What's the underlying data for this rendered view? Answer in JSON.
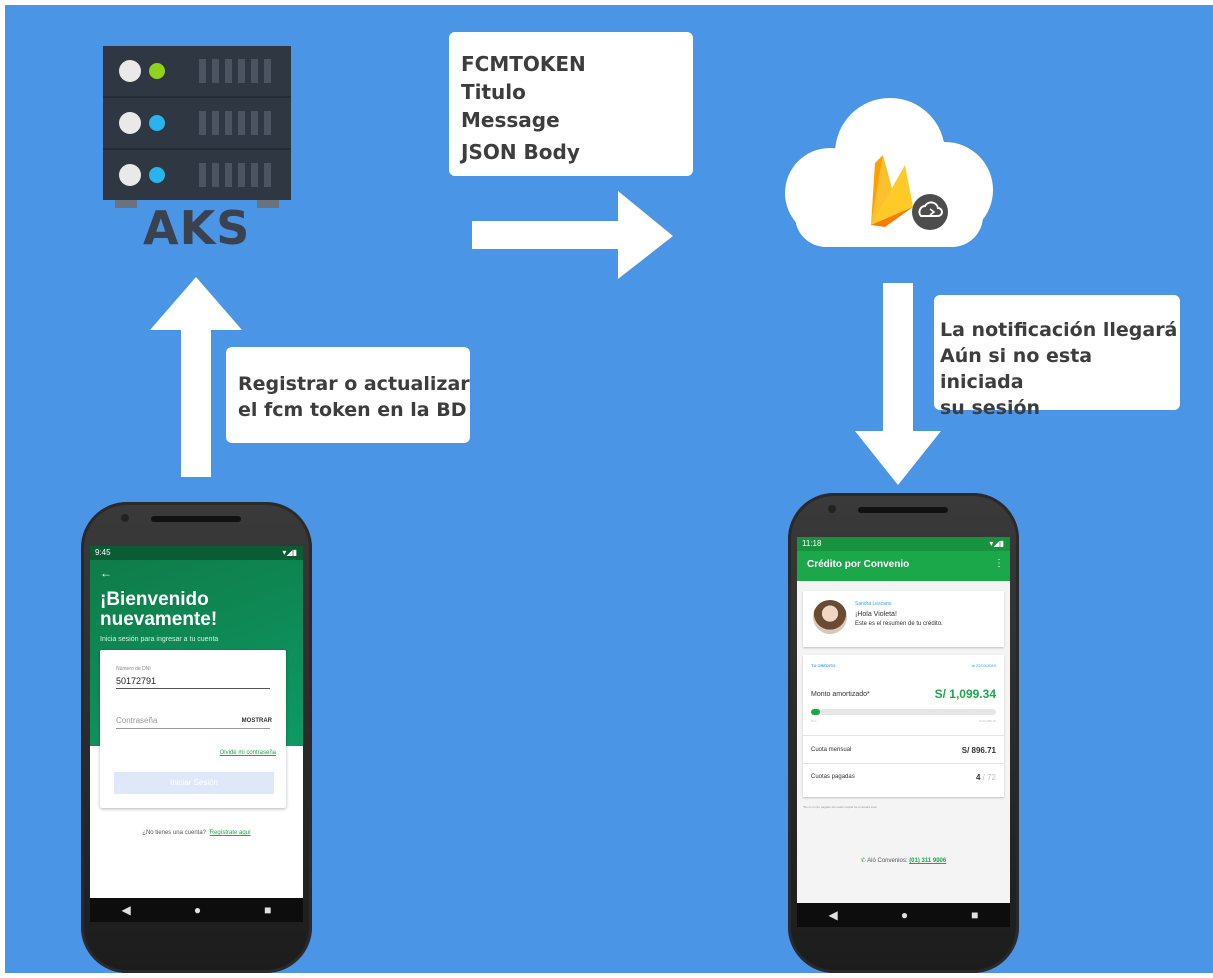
{
  "server": {
    "label": "AKS"
  },
  "payload_box": {
    "lines": [
      "FCMTOKEN",
      "Titulo",
      "Message",
      "JSON Body"
    ]
  },
  "register_box": {
    "lines": [
      "Registrar o actualizar",
      "el fcm token en la BD"
    ]
  },
  "notify_box": {
    "lines": [
      "La notificación llegará",
      "Aún si no esta iniciada",
      "su sesión"
    ]
  },
  "login_phone": {
    "status_time": "9:45",
    "back_arrow": "←",
    "welcome_line1": "¡Bienvenido",
    "welcome_line2": "nuevamente!",
    "subtitle": "Inicia sesión para ingresar a tu cuenta",
    "dni_label": "Número de DNI",
    "dni_value": "50172791",
    "password_placeholder": "Contraseña",
    "show_label": "MOSTRAR",
    "forgot_link": "Olvidé mi contraseña",
    "login_button": "Iniciar Sesión",
    "no_account": "¿No tienes una cuenta?",
    "register_link": "Regístrate aquí"
  },
  "credit_phone": {
    "status_time": "11:18",
    "app_title": "Crédito por Convenio",
    "user_name": "Sandra Lescano",
    "greeting": "¡Hola Violeta!",
    "greeting_sub": "Este es el resumen de tu crédito.",
    "section_label": "TU CRÉDITO",
    "date": "al 22/03/2019",
    "amortized_label": "Monto amortizado*",
    "amortized_value": "S/ 1,099.34",
    "progress": 0.05,
    "progress_left": "S/ 0",
    "progress_right": "S/ 22,280.15",
    "monthly_label": "Cuota mensual",
    "monthly_value": "S/ 896.71",
    "paid_label": "Cuotas pagadas",
    "paid_value": "4",
    "paid_total": "/ 72",
    "footnote": "*Es el monto pagado del saldo capital de tu deuda total.",
    "contact_label": "Aló Convenios:",
    "contact_phone": "(01) 311 9006"
  },
  "colors": {
    "background": "#4b95e6",
    "green": "#1aa84a",
    "server": "#2f3742",
    "link_blue": "#3aa0e8"
  }
}
